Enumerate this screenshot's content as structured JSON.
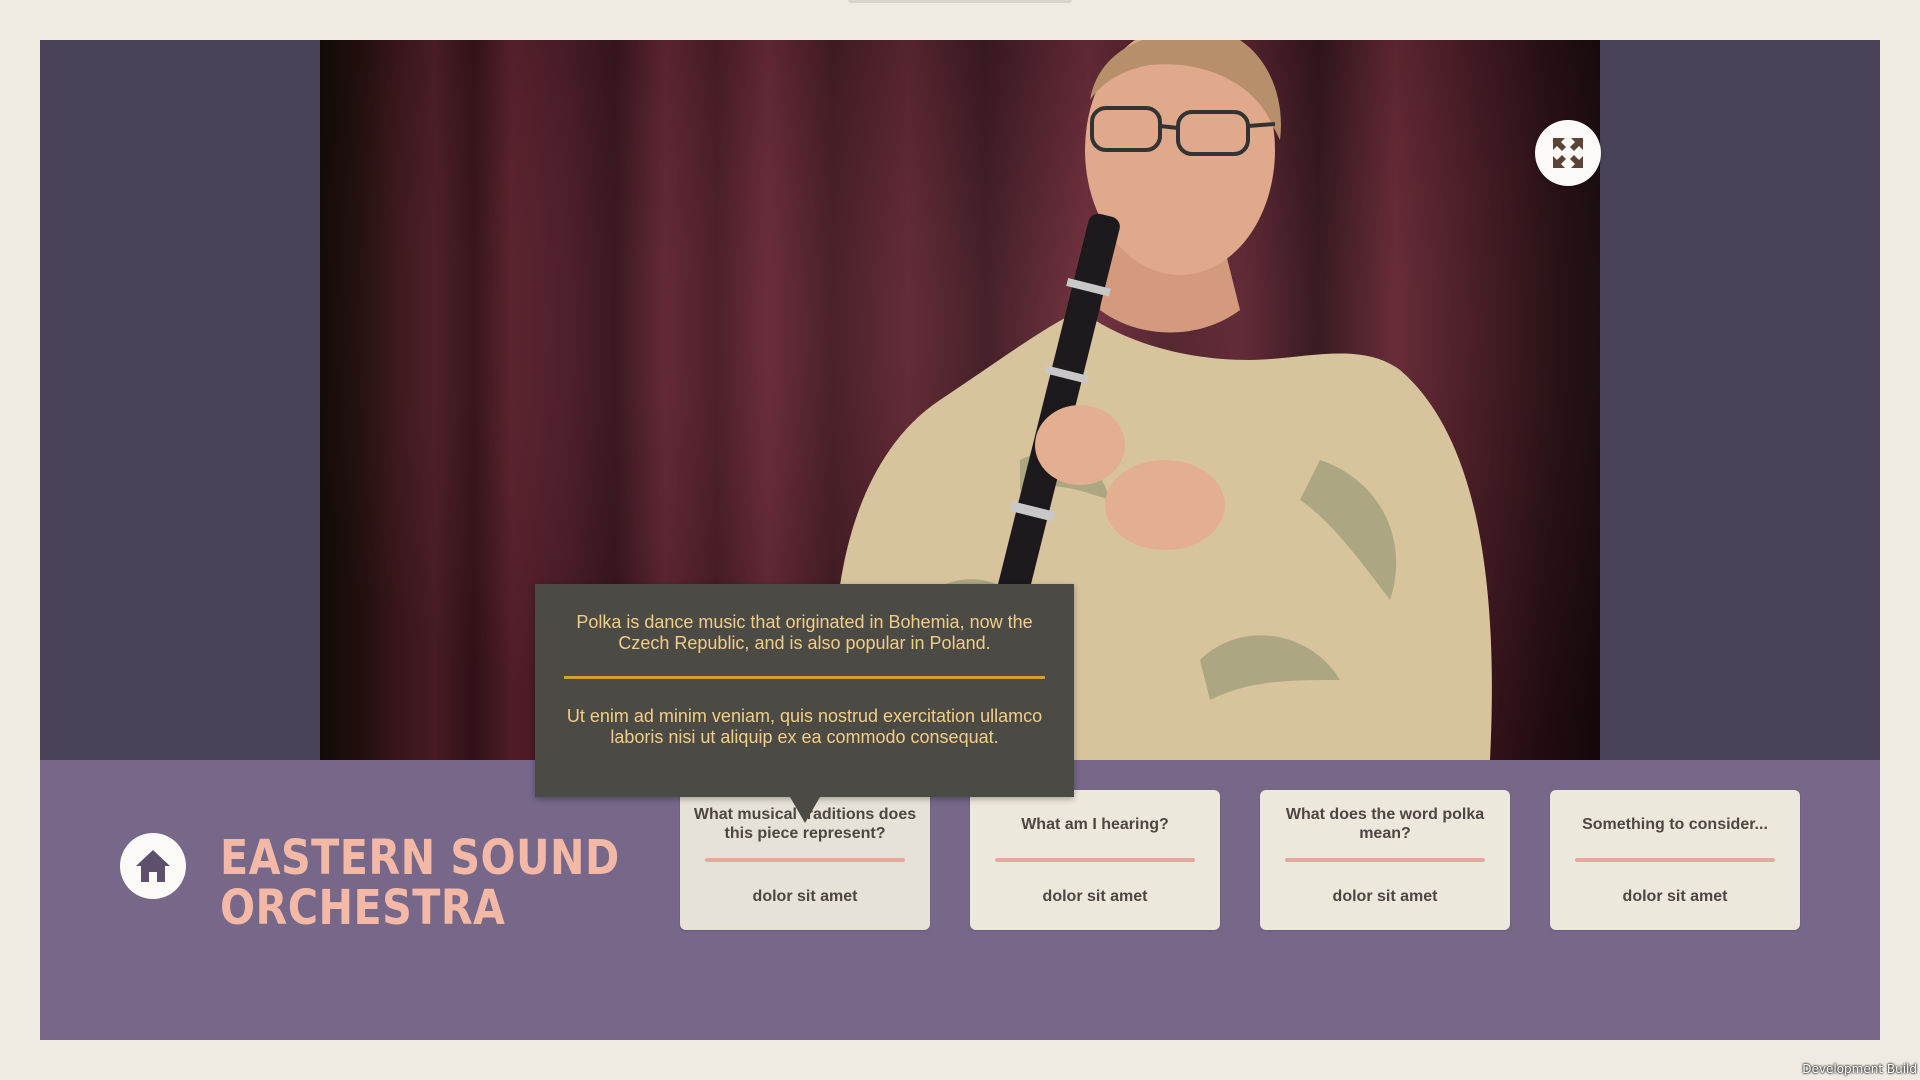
{
  "app": {
    "title": "EASTERN SOUND ORCHESTRA",
    "title_lines": [
      "EASTERN SOUND",
      "ORCHESTRA"
    ],
    "build_label": "Development Build"
  },
  "video": {
    "expand_icon": "expand-arrows-icon"
  },
  "tooltip": {
    "paragraph_1": "Polka is dance music that originated in Bohemia, now the Czech Republic, and is also popular in Poland.",
    "paragraph_2": "Ut enim ad minim veniam, quis nostrud exercitation ullamco laboris nisi ut aliquip ex ea commodo consequat."
  },
  "cards": [
    {
      "question": "What musical traditions does this piece represent?",
      "answer": "dolor sit amet"
    },
    {
      "question": "What am I hearing?",
      "answer": "dolor sit amet"
    },
    {
      "question": "What does the word polka mean?",
      "answer": "dolor sit amet"
    },
    {
      "question": "Something to consider...",
      "answer": "dolor sit amet"
    }
  ],
  "colors": {
    "page_bg": "#efebe2",
    "panel_bg": "#77688a",
    "side_bg": "#4a4256",
    "brand": "#f4b9a6",
    "tooltip_bg": "#4c4a45",
    "tooltip_text": "#f1ce87",
    "tooltip_rule": "#d59f2b",
    "card_rule": "#e3a99c"
  },
  "icons": {
    "home": "home-icon",
    "expand": "expand-arrows-icon"
  }
}
